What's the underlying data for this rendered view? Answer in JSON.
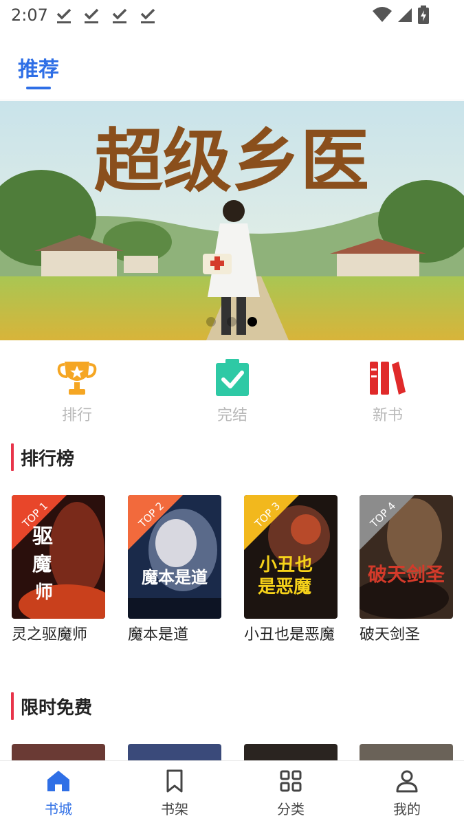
{
  "status_bar": {
    "time": "2:07",
    "download_icons": [
      "download-done-icon",
      "download-done-icon",
      "download-done-icon",
      "download-done-icon"
    ],
    "right_icons": [
      "wifi-icon",
      "signal-icon",
      "battery-charging-icon"
    ]
  },
  "top_tabs": {
    "active": "推荐"
  },
  "banner": {
    "title_art": "超级乡医",
    "slide_count": 3,
    "active_slide": 3
  },
  "quick_entries": [
    {
      "label": "排行",
      "icon": "trophy-icon"
    },
    {
      "label": "完结",
      "icon": "clipboard-check-icon"
    },
    {
      "label": "新书",
      "icon": "bookshelf-icon"
    }
  ],
  "sections": {
    "ranking": "排行榜",
    "free": "限时免费"
  },
  "ranking_books": [
    {
      "title": "灵之驱魔师",
      "rank_badge": "TOP 1",
      "badge_color": "#e8462a",
      "cover_text": "灵之驱魔师"
    },
    {
      "title": "魔本是道",
      "rank_badge": "TOP 2",
      "badge_color": "#f26a3c",
      "cover_text": "魔本是道"
    },
    {
      "title": "小丑也是恶魔",
      "rank_badge": "TOP 3",
      "badge_color": "#f2b81d",
      "cover_text": "小丑也是恶魔"
    },
    {
      "title": "破天剑圣",
      "rank_badge": "TOP 4",
      "badge_color": "#8c8c8c",
      "cover_text": "破天剑圣"
    }
  ],
  "bottom_nav": [
    {
      "label": "书城",
      "icon": "home-icon",
      "active": true
    },
    {
      "label": "书架",
      "icon": "bookmark-icon",
      "active": false
    },
    {
      "label": "分类",
      "icon": "grid-icon",
      "active": false
    },
    {
      "label": "我的",
      "icon": "user-icon",
      "active": false
    }
  ],
  "colors": {
    "accent": "#2f6fe6",
    "section_bar": "#e8344a",
    "muted_label": "#b8b8b8"
  }
}
